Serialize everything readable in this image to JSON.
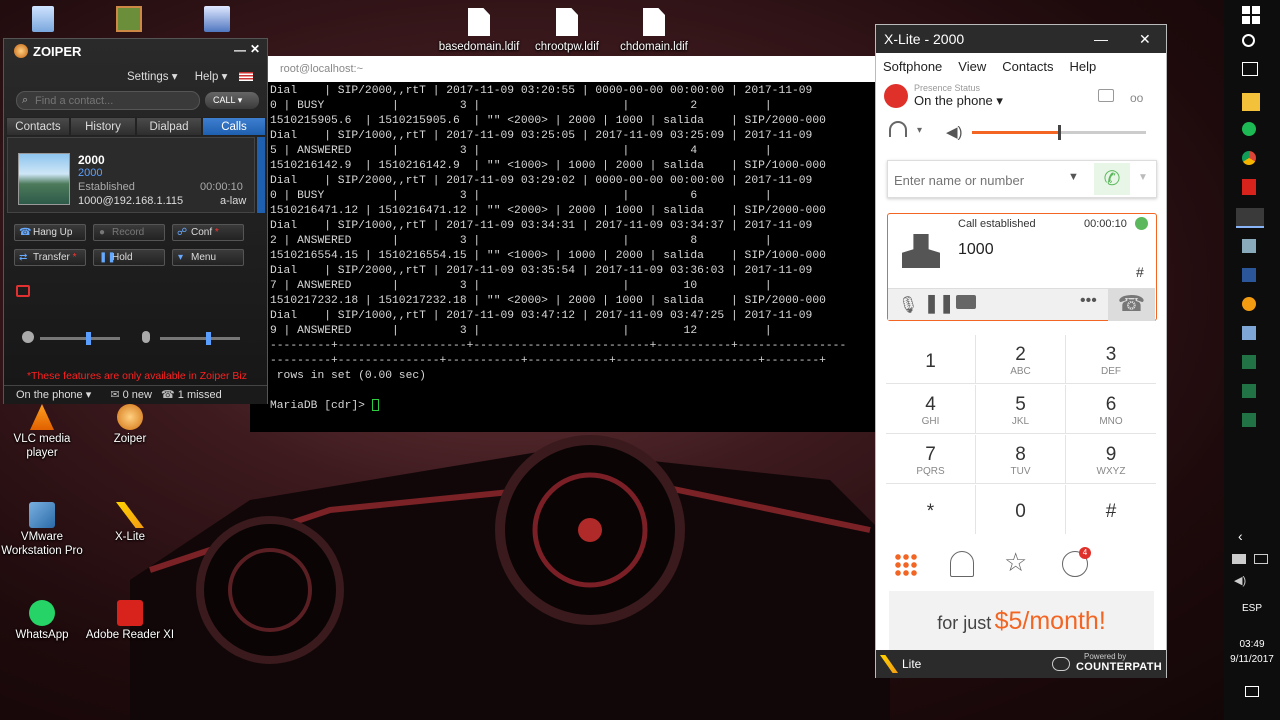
{
  "desktop": {
    "icons": [
      {
        "label": "",
        "icon": "recycle-bin-icon"
      },
      {
        "label": "",
        "icon": "installer-icon"
      },
      {
        "label": "",
        "icon": "network-computer-icon"
      },
      {
        "label": "basedomain.ldif",
        "icon": "file-icon"
      },
      {
        "label": "chrootpw.ldif",
        "icon": "file-icon"
      },
      {
        "label": "chdomain.ldif",
        "icon": "file-icon"
      },
      {
        "label": "VLC media player",
        "icon": "vlc-icon"
      },
      {
        "label": "Zoiper",
        "icon": "zoiper-icon"
      },
      {
        "label": "VMware Workstation Pro",
        "icon": "vmware-icon"
      },
      {
        "label": "X-Lite",
        "icon": "xlite-icon"
      },
      {
        "label": "WhatsApp",
        "icon": "whatsapp-icon"
      },
      {
        "label": "Adobe Reader XI",
        "icon": "adobe-reader-icon"
      }
    ]
  },
  "terminal": {
    "title": "root@localhost:~",
    "lines": [
      "Dial    | SIP/2000,,rtT | 2017-11-09 03:20:55 | 0000-00-00 00:00:00 | 2017-11-09",
      "0 | BUSY          |         3 |                     |         2          |",
      "1510215905.6  | 1510215905.6  | \"\" <2000> | 2000 | 1000 | salida    | SIP/2000-000",
      "Dial    | SIP/1000,,rtT | 2017-11-09 03:25:05 | 2017-11-09 03:25:09 | 2017-11-09",
      "5 | ANSWERED      |         3 |                     |         4          |",
      "1510216142.9  | 1510216142.9  | \"\" <1000> | 1000 | 2000 | salida    | SIP/1000-000",
      "Dial    | SIP/2000,,rtT | 2017-11-09 03:29:02 | 0000-00-00 00:00:00 | 2017-11-09",
      "0 | BUSY          |         3 |                     |         6          |",
      "1510216471.12 | 1510216471.12 | \"\" <2000> | 2000 | 1000 | salida    | SIP/2000-000",
      "Dial    | SIP/1000,,rtT | 2017-11-09 03:34:31 | 2017-11-09 03:34:37 | 2017-11-09",
      "2 | ANSWERED      |         3 |                     |         8          |",
      "1510216554.15 | 1510216554.15 | \"\" <1000> | 1000 | 2000 | salida    | SIP/1000-000",
      "Dial    | SIP/2000,,rtT | 2017-11-09 03:35:54 | 2017-11-09 03:36:03 | 2017-11-09",
      "7 | ANSWERED      |         3 |                     |        10          |",
      "1510217232.18 | 1510217232.18 | \"\" <2000> | 2000 | 1000 | salida    | SIP/2000-000",
      "Dial    | SIP/1000,,rtT | 2017-11-09 03:47:12 | 2017-11-09 03:47:25 | 2017-11-09",
      "9 | ANSWERED      |         3 |                     |        12          |",
      "---------+-------------------+--------------------------+-----------+----------------",
      "---------+---------------+-----------+------------+---------------------+--------+",
      " rows in set (0.00 sec)",
      "",
      "MariaDB [cdr]> "
    ]
  },
  "zoiper": {
    "title": "ZOIPER",
    "settings": "Settings",
    "help": "Help",
    "search_placeholder": "Find a contact...",
    "call_button": "CALL",
    "tabs": [
      "Contacts",
      "History",
      "Dialpad",
      "Calls"
    ],
    "active_tab": "Calls",
    "call": {
      "name": "2000",
      "number": "2000",
      "status": "Established",
      "duration": "00:00:10",
      "address": "1000@192.168.1.115",
      "codec": "a-law"
    },
    "buttons": {
      "hang_up": "Hang Up",
      "record": "Record",
      "conf": "Conf",
      "transfer": "Transfer",
      "hold": "Hold",
      "menu": "Menu"
    },
    "notice": "*These features are only available in Zoiper Biz",
    "status": "On the phone",
    "new_count": "0 new",
    "missed": "1 missed",
    "speaker_volume": 0.6,
    "mic_volume": 0.6
  },
  "xlite": {
    "title": "X-Lite - 2000",
    "menu": [
      "Softphone",
      "View",
      "Contacts",
      "Help"
    ],
    "presence_label": "Presence Status",
    "presence": "On the phone",
    "volume_level": 0.5,
    "dial_placeholder": "Enter name or number",
    "call": {
      "status": "Call established",
      "timer": "00:00:10",
      "number": "1000",
      "hash": "#"
    },
    "keys": [
      {
        "n": "1",
        "l": ""
      },
      {
        "n": "2",
        "l": "ABC"
      },
      {
        "n": "3",
        "l": "DEF"
      },
      {
        "n": "4",
        "l": "GHI"
      },
      {
        "n": "5",
        "l": "JKL"
      },
      {
        "n": "6",
        "l": "MNO"
      },
      {
        "n": "7",
        "l": "PQRS"
      },
      {
        "n": "8",
        "l": "TUV"
      },
      {
        "n": "9",
        "l": "WXYZ"
      },
      {
        "n": "*",
        "l": ""
      },
      {
        "n": "0",
        "l": ""
      },
      {
        "n": "#",
        "l": ""
      }
    ],
    "history_badge": "4",
    "promo_prefix": "for just",
    "promo_price": "$5/month!",
    "footer_logo": "Lite",
    "powered_by": "Powered by",
    "powered_brand": "COUNTERPATH"
  },
  "taskbar": {
    "language": "ESP",
    "time": "03:49",
    "date": "9/11/2017"
  },
  "colors": {
    "xlite_orange": "#f26522",
    "xlite_green": "#5cb85c",
    "zoiper_blue": "#1e5fb0",
    "notice_red": "#ff2020"
  }
}
